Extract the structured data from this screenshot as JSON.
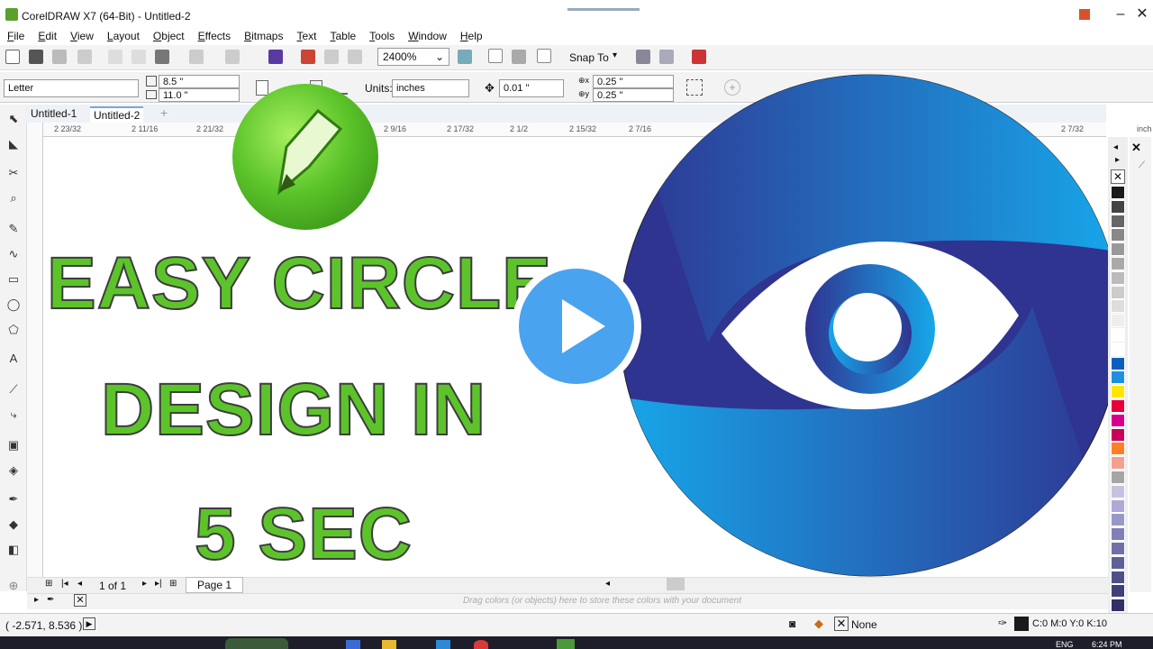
{
  "window": {
    "title": "CorelDRAW X7 (64-Bit) - Untitled-2",
    "min": "–",
    "max": "□",
    "close": "✕"
  },
  "menu": [
    "File",
    "Edit",
    "View",
    "Layout",
    "Object",
    "Effects",
    "Bitmaps",
    "Text",
    "Table",
    "Tools",
    "Window",
    "Help"
  ],
  "toolbar": {
    "zoom": "2400%",
    "snap_to": "Snap To"
  },
  "property_bar": {
    "page_size": "Letter",
    "width": "8.5 \"",
    "height": "11.0 \"",
    "units_label": "Units:",
    "units_value": "inches",
    "nudge": "0.01 \"",
    "dup_x": "0.25 \"",
    "dup_y": "0.25 \""
  },
  "tabs": [
    "Untitled-1",
    "Untitled-2"
  ],
  "ruler_labels": [
    "2 23/32",
    "2 11/16",
    "2 21/32",
    "2 9/16",
    "2 17/32",
    "2 1/2",
    "2 15/32",
    "2 7/16",
    "2 7/32",
    "inch"
  ],
  "headline": {
    "line1": "EASY CIRCLE",
    "line2": "DESIGN IN",
    "line3": "5 SEC"
  },
  "page_nav": {
    "pages": "1 of 1",
    "page_tab": "Page 1"
  },
  "palette_hint": "Drag colors (or objects) here to store these colors with your document",
  "status": {
    "coords": "( -2.571, 8.536 )",
    "fill": "None",
    "outline": "C:0 M:0 Y:0 K:10"
  },
  "taskbar": {
    "lang": "ENG",
    "time": "6:24 PM"
  },
  "palette_colors": [
    "#1a1a1a",
    "#444",
    "#666",
    "#888",
    "#999",
    "#aaa",
    "#bbb",
    "#ccc",
    "#ddd",
    "#eee",
    "#fff",
    "#ffffff",
    "#0a60c0",
    "#1f8fe0",
    "#ffe600",
    "#e8003a",
    "#d4008c",
    "#c9005a",
    "#ff7f27",
    "#f4a090",
    "#a5a5a5",
    "#c8c0e0",
    "#b0a8d8",
    "#9898c8",
    "#8080b8",
    "#7070a8",
    "#606098",
    "#505088",
    "#404078",
    "#303068",
    "#3070b0"
  ],
  "colors": {
    "accent_green": "#5cc42a",
    "circle_dark": "#303892",
    "circle_light": "#14a3e6",
    "play": "#4aa3ef"
  }
}
